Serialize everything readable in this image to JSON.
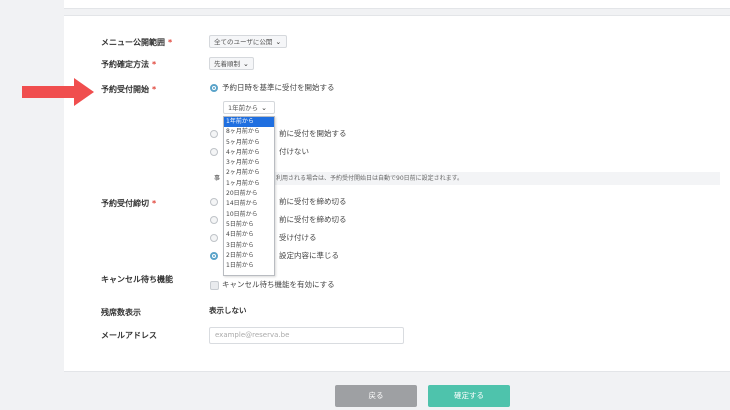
{
  "form": {
    "visibility": {
      "label": "メニュー公開範囲",
      "required_mark": "*",
      "selected": "全てのユーザに公開"
    },
    "confirm_method": {
      "label": "予約確定方法",
      "required_mark": "*",
      "selected": "先着順制"
    },
    "start": {
      "label": "予約受付開始",
      "required_mark": "*",
      "option1": "予約日時を基準に受付を開始する",
      "period_selected": "1年前から",
      "option2_tail": "前に受付を開始する",
      "option3_tail": "付けない",
      "note_prefix": "事",
      "note_tail": "利用される場合は、予約受付開始日は自動で90日前に設定されます。"
    },
    "dropdown_options": [
      "1年前から",
      "8ヶ月前から",
      "5ヶ月前から",
      "4ヶ月前から",
      "3ヶ月前から",
      "2ヶ月前から",
      "1ヶ月前から",
      "20日前から",
      "14日前から",
      "10日前から",
      "5日前から",
      "4日前から",
      "3日前から",
      "2日前から",
      "1日前から"
    ],
    "end": {
      "label": "予約受付締切",
      "required_mark": "*",
      "option1_tail": "前に受付を締め切る",
      "option2_tail": "前に受付を締め切る",
      "option3_tail": "受け付ける",
      "option4_tail": "設定内容に準じる"
    },
    "waitlist": {
      "label": "キャンセル待ち機能",
      "checkbox_label": "キャンセル待ち機能を有効にする"
    },
    "remaining": {
      "label": "残席数表示",
      "value": "表示しない"
    },
    "email": {
      "label": "メールアドレス",
      "placeholder": "example@reserva.be"
    }
  },
  "buttons": {
    "back": "戻る",
    "confirm": "確定する"
  },
  "colors": {
    "arrow": "#f04e4e",
    "accent": "#4ec3ac",
    "selected": "#1f6fe0"
  }
}
